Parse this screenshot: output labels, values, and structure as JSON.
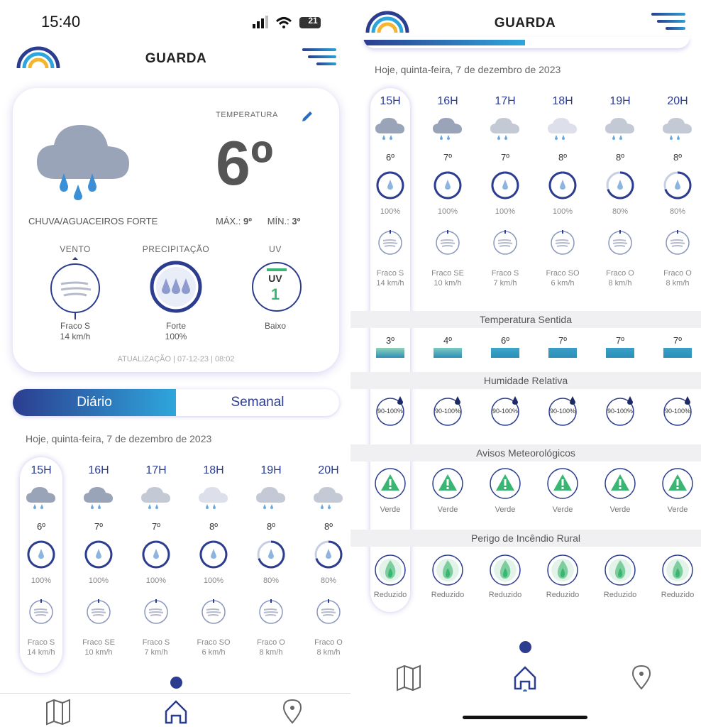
{
  "status": {
    "time": "15:40",
    "battery": "21"
  },
  "app": {
    "title": "GUARDA"
  },
  "current": {
    "temperature_label": "TEMPERATURA",
    "temperature": "6º",
    "condition": "CHUVA/AGUACEIROS FORTE",
    "max_label": "MÁX.:",
    "max": "9º",
    "min_label": "MÍN.:",
    "min": "3º",
    "wind": {
      "title": "VENTO",
      "line1": "Fraco S",
      "line2": "14 km/h"
    },
    "precip": {
      "title": "PRECIPITAÇÃO",
      "line1": "Forte",
      "line2": "100%"
    },
    "uv": {
      "title": "UV",
      "badge": "UV",
      "value": "1",
      "line1": "Baixo"
    },
    "update": "ATUALIZAÇÃO | 07-12-23 | 08:02"
  },
  "tabs": {
    "daily": "Diário",
    "weekly": "Semanal"
  },
  "date_line": "Hoje, quinta-feira, 7 de dezembro de 2023",
  "hours": [
    {
      "label": "15H",
      "temp": "6º",
      "precip": "100%",
      "wind1": "Fraco S",
      "wind2": "14 km/h",
      "feels": "3º",
      "humidity": "90-100%",
      "warning": "Verde",
      "fire": "Reduzido"
    },
    {
      "label": "16H",
      "temp": "7º",
      "precip": "100%",
      "wind1": "Fraco SE",
      "wind2": "10 km/h",
      "feels": "4º",
      "humidity": "90-100%",
      "warning": "Verde",
      "fire": "Reduzido"
    },
    {
      "label": "17H",
      "temp": "7º",
      "precip": "100%",
      "wind1": "Fraco S",
      "wind2": "7 km/h",
      "feels": "6º",
      "humidity": "90-100%",
      "warning": "Verde",
      "fire": "Reduzido"
    },
    {
      "label": "18H",
      "temp": "8º",
      "precip": "100%",
      "wind1": "Fraco SO",
      "wind2": "6 km/h",
      "feels": "7º",
      "humidity": "90-100%",
      "warning": "Verde",
      "fire": "Reduzido"
    },
    {
      "label": "19H",
      "temp": "8º",
      "precip": "80%",
      "wind1": "Fraco O",
      "wind2": "8 km/h",
      "feels": "7º",
      "humidity": "90-100%",
      "warning": "Verde",
      "fire": "Reduzido"
    },
    {
      "label": "20H",
      "temp": "8º",
      "precip": "80%",
      "wind1": "Fraco O",
      "wind2": "8 km/h",
      "feels": "7º",
      "humidity": "90-100%",
      "warning": "Verde",
      "fire": "Reduzido"
    }
  ],
  "sections": {
    "feels": "Temperatura Sentida",
    "humidity": "Humidade Relativa",
    "warnings": "Avisos Meteorológicos",
    "fire": "Perigo de Incêndio Rural"
  },
  "icons": {
    "nav": [
      "map-icon",
      "home-icon",
      "location-icon"
    ]
  },
  "colors": {
    "accent": "#2c3d8f",
    "accent_light": "#2ea6dc",
    "warning_green": "#3bb573"
  }
}
